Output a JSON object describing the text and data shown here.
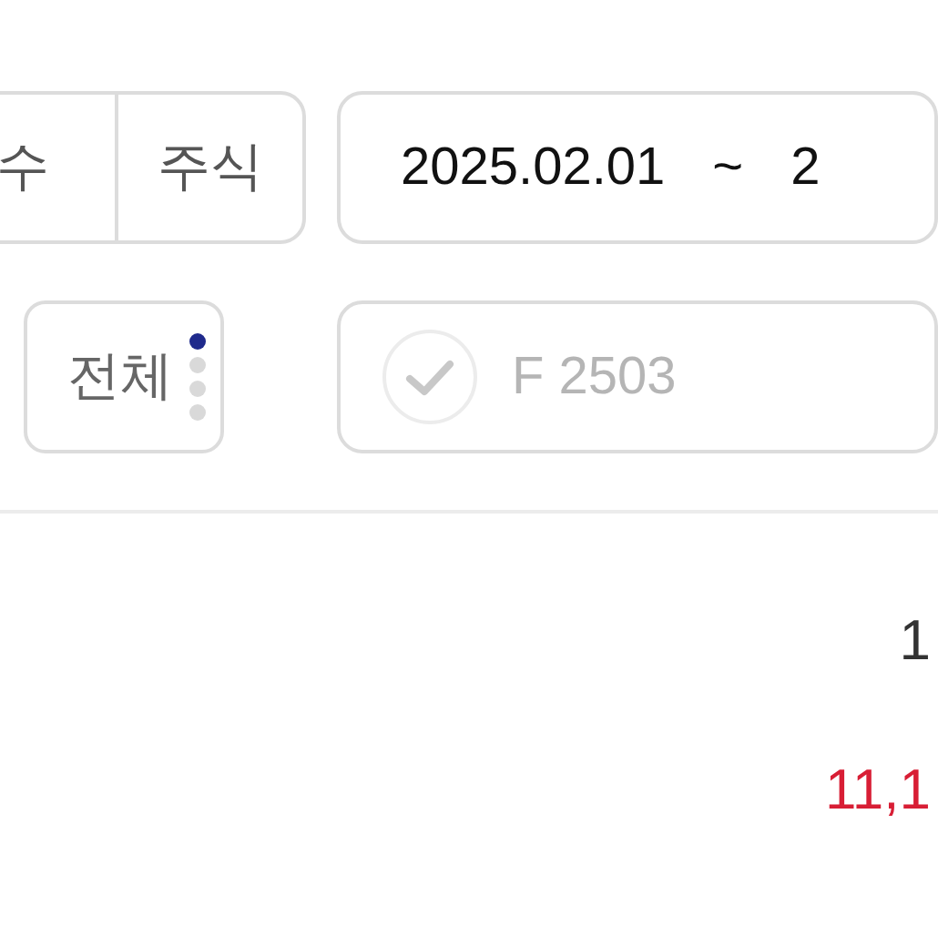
{
  "segments": [
    {
      "label": "수"
    },
    {
      "label": "주식"
    }
  ],
  "date_range": {
    "start": "2025.02.01",
    "separator": "~",
    "end": "2"
  },
  "type_filter": {
    "label": "전체",
    "pages": [
      {
        "selected": true
      },
      {
        "selected": false
      },
      {
        "selected": false
      },
      {
        "selected": false
      }
    ]
  },
  "contract_field": {
    "value": "F 2503",
    "checked": false
  },
  "values": [
    {
      "text": "1",
      "kind": "plain"
    },
    {
      "text": "11,1",
      "kind": "rise"
    }
  ]
}
